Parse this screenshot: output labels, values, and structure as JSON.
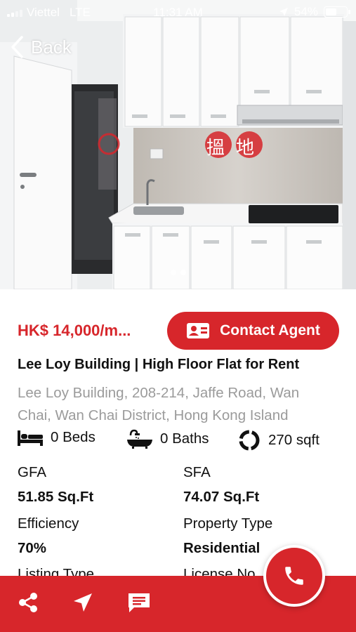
{
  "status_bar": {
    "carrier": "Viettel",
    "network": "LTE",
    "time": "11:31 AM",
    "battery": "54%",
    "battery_level": 0.54
  },
  "nav": {
    "back_label": "Back"
  },
  "gallery": {
    "image_count": 2,
    "active_index": 1,
    "watermark_text": "搵地"
  },
  "listing": {
    "price": "HK$ 14,000/m...",
    "contact_label": "Contact Agent",
    "title": "Lee Loy Building |  High Floor Flat for Rent",
    "address_line1": "Lee Loy Building, 208-214, Jaffe Road, Wan",
    "address_line2": "Chai, Wan Chai District, Hong Kong Island"
  },
  "features": {
    "beds": "0 Beds",
    "baths": "0 Baths",
    "area": "270 sqft"
  },
  "specs": {
    "gfa_label": "GFA",
    "gfa_value": "51.85 Sq.Ft",
    "sfa_label": "SFA",
    "sfa_value": "74.07 Sq.Ft",
    "efficiency_label": "Efficiency",
    "efficiency_value": "70%",
    "property_type_label": "Property Type",
    "property_type_value": "Residential",
    "listing_type_label": "Listing Type",
    "license_label": "License No."
  },
  "colors": {
    "brand_red": "#d7262b",
    "address_grey": "#9b9b9b"
  },
  "icons": {
    "share": "share-icon",
    "navigate": "navigation-arrow-icon",
    "message": "message-icon",
    "call": "phone-icon",
    "bed": "bed-icon",
    "bath": "bathtub-icon",
    "area": "area-ring-icon",
    "contact": "contact-card-icon"
  }
}
